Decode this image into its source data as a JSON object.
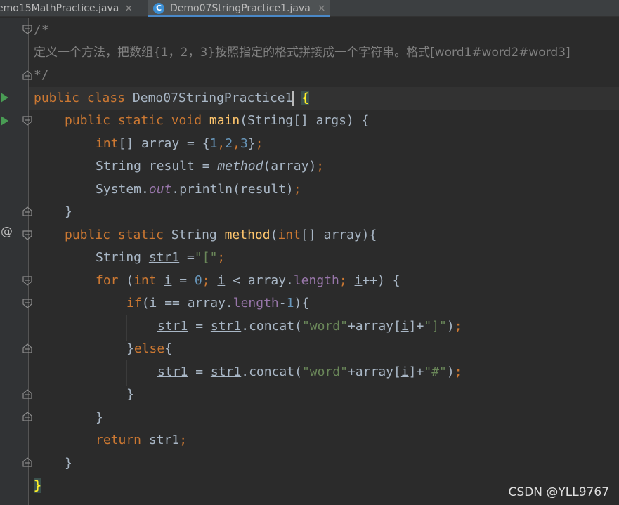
{
  "tabs": [
    {
      "label": "emo15MathPractice.java",
      "close": "×"
    },
    {
      "label": "Demo07StringPractice1.java",
      "close": "×",
      "icon": "C"
    }
  ],
  "gutter": {
    "override_marker": "@"
  },
  "code": {
    "l1": "/*",
    "l2": "定义一个方法，把数组{1，2，3}按照指定的格式拼接成一个字符串。格式[word1#word2#word3]",
    "l3": "*/",
    "l4": {
      "kw": "public class ",
      "name": "Demo07StringPractice1",
      "brace": "{"
    },
    "l5": {
      "kw": "public static void ",
      "fn": "main",
      "rest": "(String[] args) {"
    },
    "l6": {
      "kw": "int",
      "a": "[] array = {",
      "n1": "1",
      "c1": ",",
      "n2": "2",
      "c2": ",",
      "n3": "3",
      "b": "}",
      "semi": ";"
    },
    "l7": {
      "a": "String result = ",
      "m": "method",
      "b": "(array)",
      "semi": ";"
    },
    "l8": {
      "a": "System.",
      "out": "out",
      "b": ".println(result)",
      "semi": ";"
    },
    "l9": "}",
    "l10": {
      "kw": "public static ",
      "type": "String ",
      "fn": "method",
      "p1": "(",
      "kw2": "int",
      "p2": "[] array){"
    },
    "l11": {
      "a": "String ",
      "v": "str1",
      "b": " =",
      "s": "\"[\"",
      "semi": ";"
    },
    "l12": {
      "kw": "for ",
      "p1": "(",
      "kw2": "int ",
      "i1": "i",
      "eq": " = ",
      "z": "0",
      "s1": "; ",
      "i2": "i",
      "lt": " < array.",
      "len": "length",
      "s2": "; ",
      "i3": "i",
      "pp": "++) {"
    },
    "l13": {
      "kw": "if",
      "p1": "(",
      "i": "i",
      "eq": " == array.",
      "len": "length",
      "m": "-",
      "one": "1",
      "p2": "){"
    },
    "l14": {
      "v1": "str1",
      "eq": " = ",
      "v2": "str1",
      "c": ".concat(",
      "s1": "\"word\"",
      "pl1": "+array[",
      "i": "i",
      "pl2": "]+",
      "s2": "\"]\"",
      "end": ")",
      "semi": ";"
    },
    "l15": {
      "a": "}",
      "kw": "else",
      "b": "{"
    },
    "l16": {
      "v1": "str1",
      "eq": " = ",
      "v2": "str1",
      "c": ".concat(",
      "s1": "\"word\"",
      "pl1": "+array[",
      "i": "i",
      "pl2": "]+",
      "s2": "\"#\"",
      "end": ")",
      "semi": ";"
    },
    "l17": "}",
    "l18": "}",
    "l19": {
      "kw": "return ",
      "v": "str1",
      "semi": ";"
    },
    "l20": "}",
    "l21": "}"
  },
  "watermark": "CSDN @YLL9767",
  "colors": {
    "background": "#2b2b2b",
    "keyword": "#cc7832",
    "function": "#ffc66d",
    "number": "#6897bb",
    "string": "#6a8759",
    "field": "#9876aa",
    "comment": "#808080",
    "text": "#a9b7c6"
  }
}
